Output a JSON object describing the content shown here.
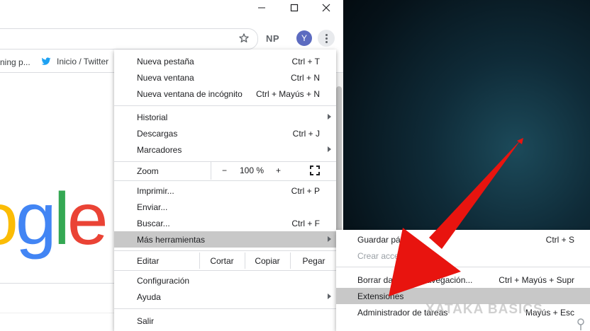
{
  "window": {
    "minimize_icon": "minimize-icon",
    "maximize_icon": "maximize-icon",
    "close_icon": "close-icon"
  },
  "toolbar": {
    "star_icon": "star-icon",
    "extension_label": "NP",
    "avatar_letter": "Y",
    "menu_icon": "kebab-menu-icon"
  },
  "bookmarks": [
    {
      "label": "ning p..."
    },
    {
      "label": "Inicio / Twitter",
      "icon": "twitter-icon"
    }
  ],
  "google_logo": {
    "letters": [
      "o",
      "g",
      "l",
      "e"
    ],
    "colors": [
      "#FBBC05",
      "#4285F4",
      "#34A853",
      "#EA4335"
    ]
  },
  "menu": {
    "items": [
      {
        "label": "Nueva pestaña",
        "shortcut": "Ctrl + T"
      },
      {
        "label": "Nueva ventana",
        "shortcut": "Ctrl + N"
      },
      {
        "label": "Nueva ventana de incógnito",
        "shortcut": "Ctrl + Mayús + N"
      },
      {
        "label": "Historial",
        "shortcut": ""
      },
      {
        "label": "Descargas",
        "shortcut": "Ctrl + J"
      },
      {
        "label": "Marcadores",
        "shortcut": ""
      },
      {
        "label": "Imprimir...",
        "shortcut": "Ctrl + P"
      },
      {
        "label": "Enviar...",
        "shortcut": ""
      },
      {
        "label": "Buscar...",
        "shortcut": "Ctrl + F"
      },
      {
        "label": "Más herramientas",
        "shortcut": ""
      },
      {
        "label": "Configuración",
        "shortcut": ""
      },
      {
        "label": "Ayuda",
        "shortcut": ""
      },
      {
        "label": "Salir",
        "shortcut": ""
      }
    ],
    "zoom": {
      "label": "Zoom",
      "minus": "−",
      "value": "100 %",
      "plus": "+"
    },
    "edit": {
      "label": "Editar",
      "cut": "Cortar",
      "copy": "Copiar",
      "paste": "Pegar"
    }
  },
  "submenu": {
    "items": [
      {
        "label": "Guardar pág",
        "shortcut": "Ctrl + S"
      },
      {
        "label": "Crear acces",
        "shortcut": ""
      },
      {
        "label": "Borrar da",
        "label2": "navegación...",
        "shortcut": "Ctrl + Mayús + Supr"
      },
      {
        "label": "Extensiones",
        "shortcut": ""
      },
      {
        "label": "Administrador de tareas",
        "shortcut": "Mayús + Esc"
      }
    ]
  },
  "watermark": "XATAKA BASICS",
  "colors": {
    "highlight": "#c8c8c8",
    "arrow": "#e8140f",
    "avatar": "#5c6bc0"
  }
}
